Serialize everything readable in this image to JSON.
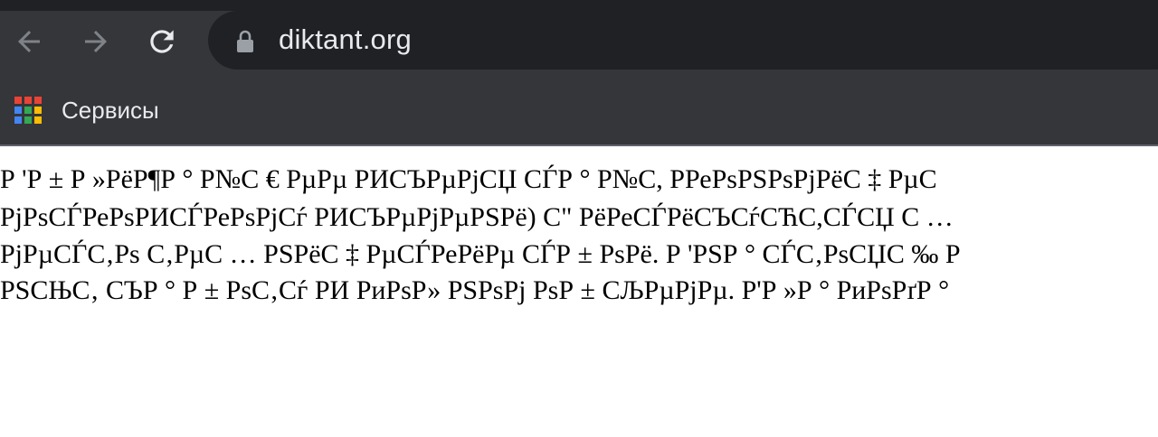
{
  "browser": {
    "url": "diktant.org",
    "bookmarks": [
      {
        "label": "Сервисы",
        "icon": "apps-grid-icon"
      }
    ],
    "colors": {
      "chrome_bg": "#35363a",
      "omnibox_bg": "#202124",
      "text": "#e8eaed",
      "icon": "#9aa0a6"
    }
  },
  "page": {
    "lines": [
      "Р 'Р ± Р »РёР¶Р ° Р№С € РµРµ РИСЪРµРјСЏ СЃР ° Р№С, РРеРѕРЅРѕРјРёС ‡ РµС",
      "РјРѕСЃРеРѕРИСЃРеРѕРјСѓ РИСЪРµРјРµРЅРё) С\" РёРеСЃРёСЪСѓСЋС,СЃСЏ С …",
      "РјРµСЃС‚Рѕ С‚РµС … РЅРёС ‡ РµСЃРеРёРµ СЃР ± РѕРё. Р 'РЅР ° СЃС‚РѕСЏС ‰ Р",
      "РЅСЊС‚ СЪР ° Р ± РѕС‚Сѓ РИ РиРѕР» РЅРѕРј РѕР ± СЉРµРјРµ. Р'Р »Р ° РиРѕРґР °"
    ]
  }
}
